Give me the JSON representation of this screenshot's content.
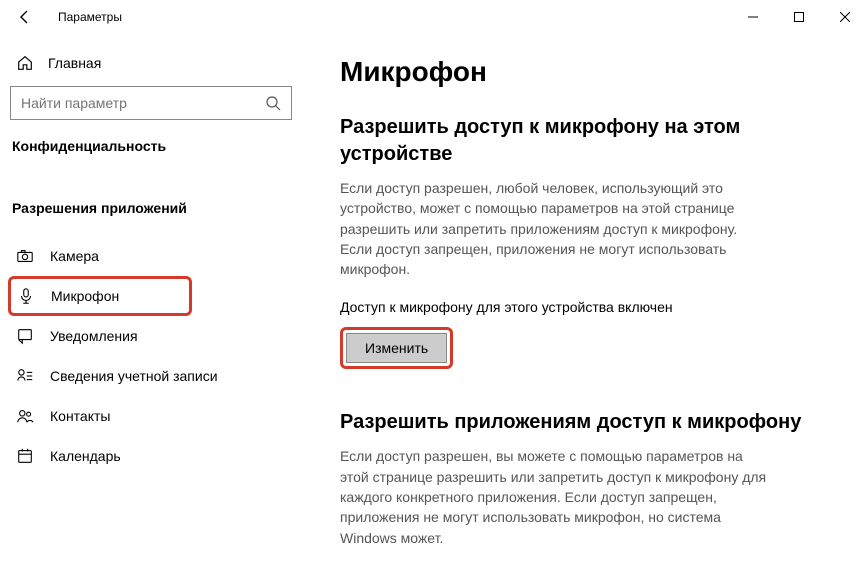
{
  "window": {
    "title": "Параметры"
  },
  "sidebar": {
    "home": "Главная",
    "search_placeholder": "Найти параметр",
    "section1": "Конфиденциальность",
    "section2": "Разрешения приложений",
    "items": [
      {
        "label": "Камера"
      },
      {
        "label": "Микрофон"
      },
      {
        "label": "Уведомления"
      },
      {
        "label": "Сведения учетной записи"
      },
      {
        "label": "Контакты"
      },
      {
        "label": "Календарь"
      }
    ]
  },
  "main": {
    "title": "Микрофон",
    "h2a": "Разрешить доступ к микрофону на этом устройстве",
    "desc_a": "Если доступ разрешен, любой человек, использующий это устройство, может с помощью параметров на этой странице разрешить или запретить приложениям доступ к микрофону. Если доступ запрещен, приложения не могут использовать микрофон.",
    "status": "Доступ к микрофону для этого устройства включен",
    "change_btn": "Изменить",
    "h2b": "Разрешить приложениям доступ к микрофону",
    "desc_b": "Если доступ разрешен, вы можете с помощью параметров на этой странице разрешить или запретить доступ к микрофону для каждого конкретного приложения. Если доступ запрещен, приложения не могут использовать микрофон, но система Windows может."
  }
}
